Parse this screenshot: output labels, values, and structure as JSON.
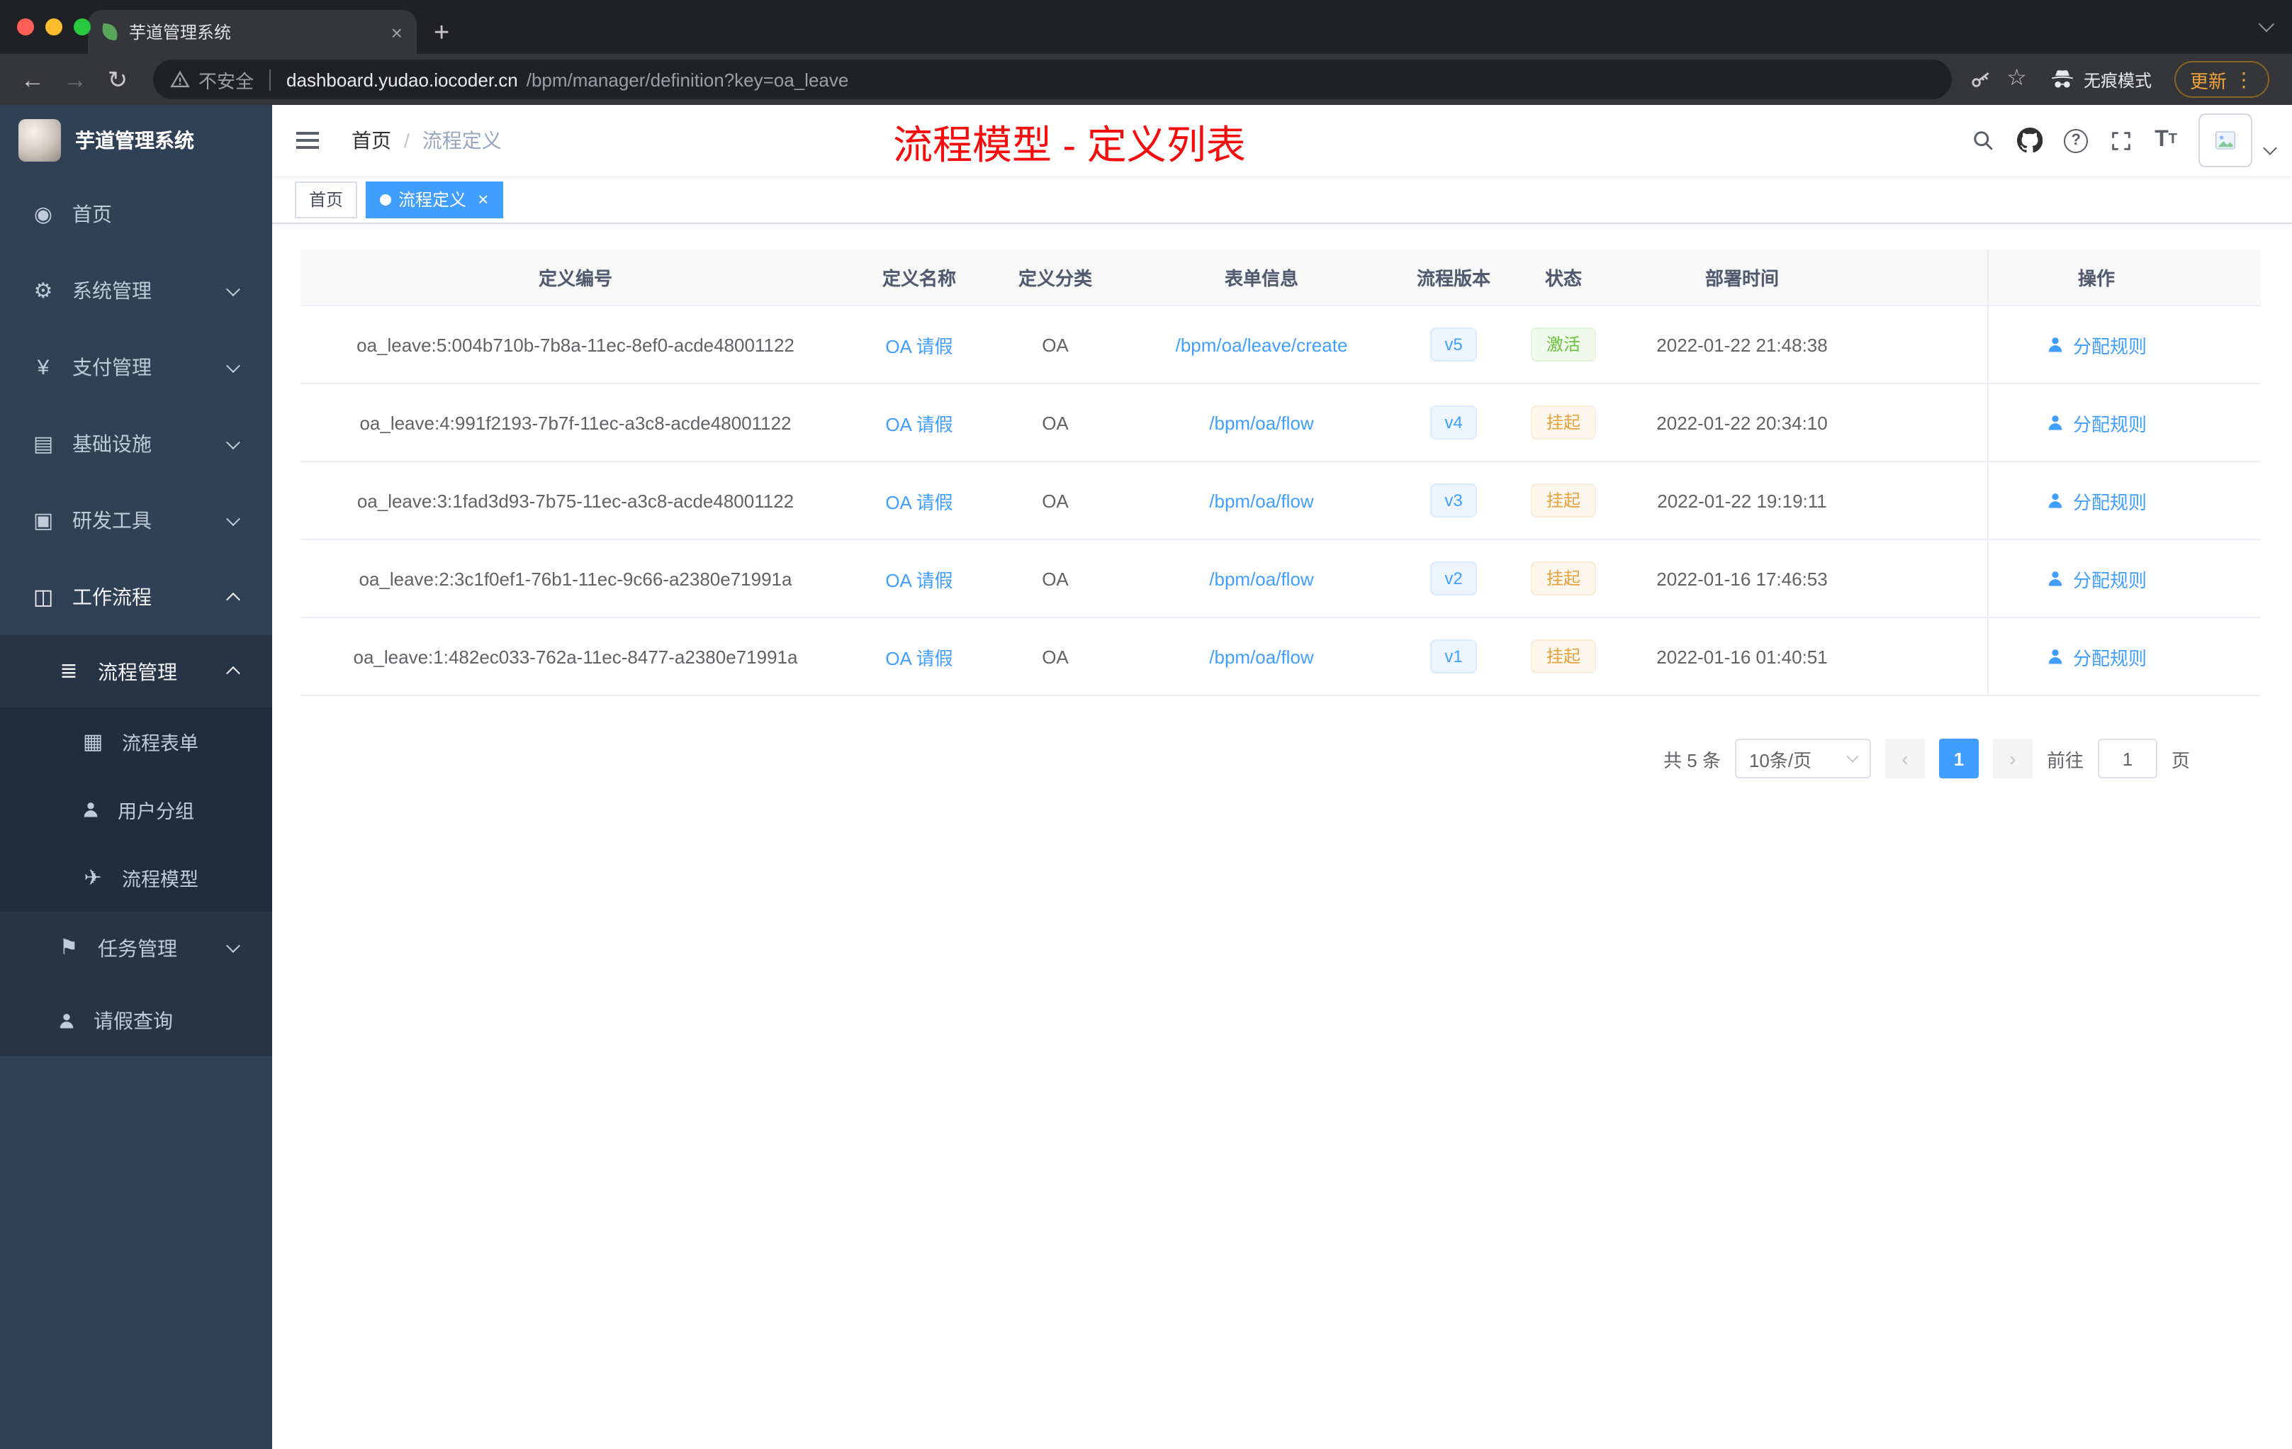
{
  "browser": {
    "tab": {
      "title": "芋道管理系统"
    },
    "url": {
      "security": "不安全",
      "host": "dashboard.yudao.iocoder.cn",
      "path": "/bpm/manager/definition?key=oa_leave"
    },
    "incognito_label": "无痕模式",
    "update_label": "更新"
  },
  "annotation": "流程模型 - 定义列表",
  "sidebar": {
    "logo_title": "芋道管理系统",
    "menu": [
      {
        "label": "首页"
      },
      {
        "label": "系统管理"
      },
      {
        "label": "支付管理"
      },
      {
        "label": "基础设施"
      },
      {
        "label": "研发工具"
      },
      {
        "label": "工作流程"
      },
      {
        "label": "流程管理"
      },
      {
        "label": "流程表单"
      },
      {
        "label": "用户分组"
      },
      {
        "label": "流程模型"
      },
      {
        "label": "任务管理"
      },
      {
        "label": "请假查询"
      }
    ]
  },
  "navbar": {
    "breadcrumb": [
      "首页",
      "流程定义"
    ]
  },
  "tags": [
    {
      "label": "首页",
      "active": false
    },
    {
      "label": "流程定义",
      "active": true
    }
  ],
  "table": {
    "columns": [
      "定义编号",
      "定义名称",
      "定义分类",
      "表单信息",
      "流程版本",
      "状态",
      "部署时间",
      "操作"
    ],
    "action_label": "分配规则",
    "rows": [
      {
        "id": "oa_leave:5:004b710b-7b8a-11ec-8ef0-acde48001122",
        "name": "OA 请假",
        "category": "OA",
        "form": "/bpm/oa/leave/create",
        "version": "v5",
        "status": "激活",
        "status_type": "success",
        "deploy_time": "2022-01-22 21:48:38"
      },
      {
        "id": "oa_leave:4:991f2193-7b7f-11ec-a3c8-acde48001122",
        "name": "OA 请假",
        "category": "OA",
        "form": "/bpm/oa/flow",
        "version": "v4",
        "status": "挂起",
        "status_type": "warning",
        "deploy_time": "2022-01-22 20:34:10"
      },
      {
        "id": "oa_leave:3:1fad3d93-7b75-11ec-a3c8-acde48001122",
        "name": "OA 请假",
        "category": "OA",
        "form": "/bpm/oa/flow",
        "version": "v3",
        "status": "挂起",
        "status_type": "warning",
        "deploy_time": "2022-01-22 19:19:11"
      },
      {
        "id": "oa_leave:2:3c1f0ef1-76b1-11ec-9c66-a2380e71991a",
        "name": "OA 请假",
        "category": "OA",
        "form": "/bpm/oa/flow",
        "version": "v2",
        "status": "挂起",
        "status_type": "warning",
        "deploy_time": "2022-01-16 17:46:53"
      },
      {
        "id": "oa_leave:1:482ec033-762a-11ec-8477-a2380e71991a",
        "name": "OA 请假",
        "category": "OA",
        "form": "/bpm/oa/flow",
        "version": "v1",
        "status": "挂起",
        "status_type": "warning",
        "deploy_time": "2022-01-16 01:40:51"
      }
    ]
  },
  "pagination": {
    "total": "共 5 条",
    "page_size": "10条/页",
    "current_page": "1",
    "goto_prefix": "前往",
    "goto_value": "1",
    "goto_suffix": "页"
  },
  "icons": {
    "dashboard": "◉",
    "gear": "⚙",
    "pay": "¥",
    "infra": "▤",
    "dev": "▣",
    "workflow": "◫",
    "process": "≣",
    "form": "▦",
    "model": "✈",
    "task": "⚑",
    "back": "←",
    "forward": "→",
    "refresh": "↻",
    "star": "☆",
    "dots": "⋮",
    "plus": "+",
    "close": "×",
    "prev": "‹",
    "next": "›"
  },
  "colors": {
    "accent": "#409eff",
    "success": "#67c23a",
    "warning": "#e6a23c",
    "annotation_red": "#f50d0d",
    "sidebar_bg": "#304156",
    "chrome_bg": "#35363a"
  }
}
